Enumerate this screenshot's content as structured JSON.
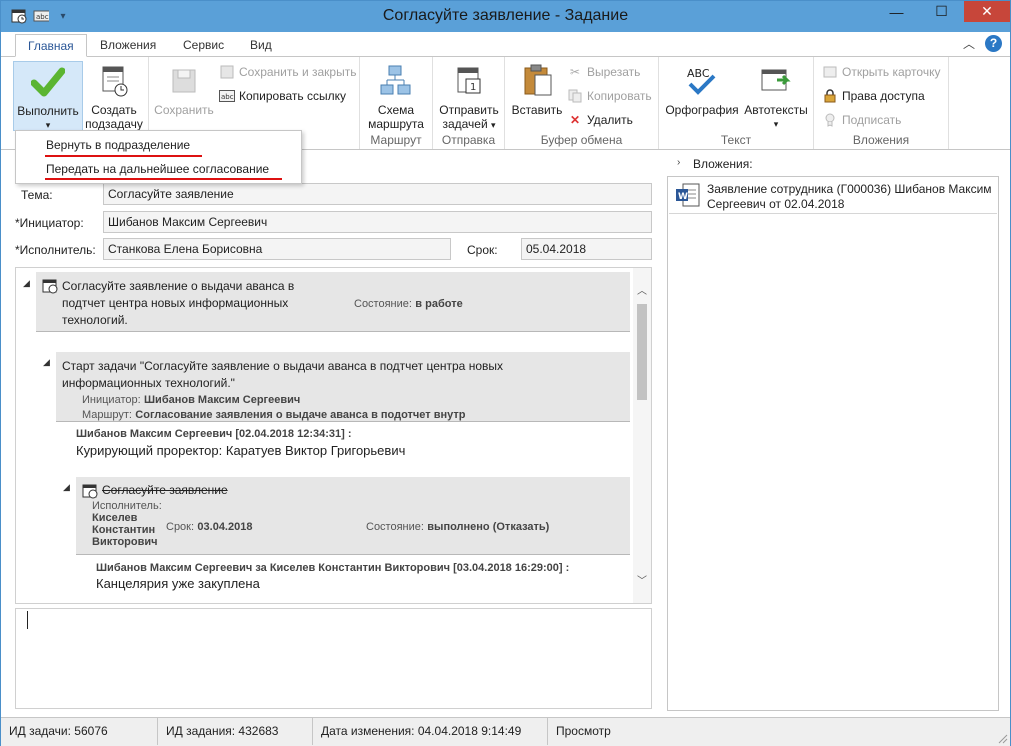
{
  "window": {
    "title": "Согласуйте заявление - Задание",
    "min_glyph": "—",
    "max_glyph": "☐",
    "close_glyph": "✕"
  },
  "tabs": [
    {
      "label": "Главная",
      "active": true
    },
    {
      "label": "Вложения"
    },
    {
      "label": "Сервис"
    },
    {
      "label": "Вид"
    }
  ],
  "ribbon": {
    "execute": {
      "label": "Выполнить",
      "arrow": "▾"
    },
    "create_subtask": {
      "line1": "Создать",
      "line2": "подзадачу"
    },
    "save": {
      "label": "Сохранить"
    },
    "save_close": {
      "label": "Сохранить и закрыть"
    },
    "copy_link": {
      "label": "Копировать ссылку"
    },
    "route_scheme": {
      "line1": "Схема",
      "line2": "маршрута"
    },
    "send": {
      "line1": "Отправить",
      "line2": "задачей",
      "arrow": "▾"
    },
    "paste": {
      "label": "Вставить"
    },
    "cut": {
      "label": "Вырезать"
    },
    "copy": {
      "label": "Копировать"
    },
    "delete": {
      "label": "Удалить"
    },
    "spelling": {
      "label": "Орфография",
      "icon_text": "ABC"
    },
    "autotext": {
      "label": "Автотексты",
      "arrow": "▾"
    },
    "open_card": {
      "label": "Открыть карточку"
    },
    "access_rights": {
      "label": "Права доступа"
    },
    "sign": {
      "label": "Подписать"
    },
    "groups": {
      "route": "Маршрут",
      "send": "Отправка",
      "clipboard": "Буфер обмена",
      "text": "Текст",
      "attachments": "Вложения"
    }
  },
  "dropdown": {
    "items": [
      "Вернуть в подразделение",
      "Передать на дальнейшее согласование"
    ],
    "underline_color": "#dd1111"
  },
  "form": {
    "subject_label": "Тема:",
    "subject_value": "Согласуйте заявление",
    "initiator_label": "*Инициатор:",
    "initiator_value": "Шибанов Максим Сергеевич",
    "performer_label": "*Исполнитель:",
    "performer_value": "Станкова Елена Борисовна",
    "deadline_label": "Срок:",
    "deadline_value": "05.04.2018"
  },
  "history": {
    "task_title_l1": "Согласуйте заявление о выдачи аванса в",
    "task_title_l2": "подтчет центра новых информационных",
    "task_title_l3": "технологий.",
    "task_state_label": "Состояние:",
    "task_state_value": "в работе",
    "start_l1": "Старт задачи \"Согласуйте заявление о выдачи аванса в подтчет центра новых",
    "start_l2": "информационных технологий.\"",
    "start_initiator_label": "Инициатор:",
    "start_initiator_value": "Шибанов Максим Сергеевич",
    "start_route_label": "Маршрут:",
    "start_route_value": "Согласование заявления о выдаче аванса в подотчет внутр",
    "comment1_header": "Шибанов Максим Сергеевич [02.04.2018 12:34:31] :",
    "comment1_text": "Курирующий проректор: Каратуев Виктор Григорьевич",
    "subtask_title": "Согласуйте заявление",
    "subtask_performer_label": "Исполнитель:",
    "subtask_performer_l1": "Киселев",
    "subtask_performer_l2": "Константин",
    "subtask_performer_l3": "Викторович",
    "subtask_deadline_label": "Срок:",
    "subtask_deadline_value": "03.04.2018",
    "subtask_state_label": "Состояние:",
    "subtask_state_value": "выполнено (Отказать)",
    "comment2_header": "Шибанов Максим Сергеевич за Киселев Константин Викторович [03.04.2018 16:29:00] :",
    "comment2_text": "Канцелярия уже закуплена"
  },
  "attachments": {
    "header": "Вложения:",
    "item_l1": "Заявление сотрудника (Г000036) Шибанов Максим",
    "item_l2": "Сергеевич  от 02.04.2018"
  },
  "status": {
    "task_id": "ИД задачи: 56076",
    "job_id": "ИД задания: 432683",
    "modified": "Дата изменения: 04.04.2018 9:14:49",
    "mode": "Просмотр"
  },
  "colors": {
    "titlebar": "#5aa0d8",
    "accent": "#2b78c5",
    "close": "#c7463a",
    "check": "#5bb531"
  }
}
